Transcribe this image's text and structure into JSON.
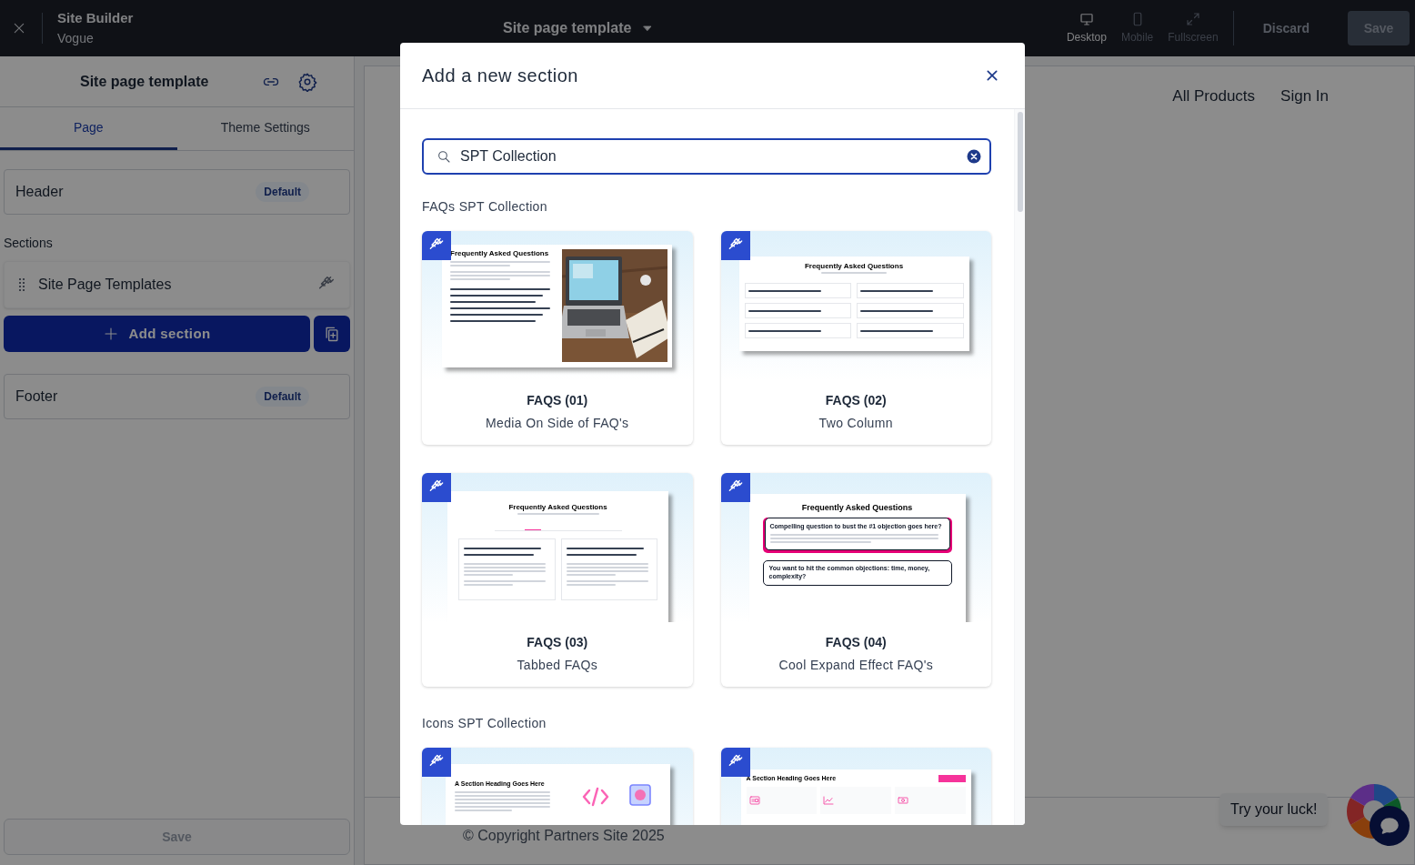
{
  "topbar": {
    "app_title": "Site Builder",
    "site_name": "Vogue",
    "page_selector": "Site page template",
    "devices": [
      {
        "label": "Desktop",
        "kind": "desktop",
        "selected": true
      },
      {
        "label": "Mobile",
        "kind": "mobile",
        "selected": false
      },
      {
        "label": "Fullscreen",
        "kind": "fullscreen",
        "selected": false
      }
    ],
    "discard": {
      "label": "Discard",
      "disabled": true
    },
    "save": {
      "label": "Save",
      "disabled": true
    }
  },
  "sidebar": {
    "title": "Site page template",
    "tabs": [
      {
        "label": "Page",
        "selected": true
      },
      {
        "label": "Theme Settings",
        "selected": false
      }
    ],
    "header": {
      "label": "Header",
      "badge": "Default"
    },
    "sections_label": "Sections",
    "sections": [
      {
        "label": "Site Page Templates"
      }
    ],
    "add_section": "Add section",
    "footer": {
      "label": "Footer",
      "badge": "Default"
    },
    "save": {
      "label": "Save",
      "disabled": true
    }
  },
  "preview": {
    "nav": [
      "All Products",
      "Sign In"
    ],
    "copyright": "© Copyright Partners Site 2025",
    "promo": "Try your luck!"
  },
  "modal": {
    "title": "Add a new section",
    "search": {
      "value": "SPT Collection"
    },
    "groups": [
      {
        "title": "FAQs SPT Collection",
        "cards": [
          {
            "title": "FAQS (01)",
            "subtitle": "Media On Side of FAQ's",
            "preview": {
              "kind": "media_side",
              "heading": "Frequently Asked Questions"
            }
          },
          {
            "title": "FAQS (02)",
            "subtitle": "Two Column",
            "preview": {
              "kind": "two_column",
              "heading": "Frequently Asked Questions"
            }
          },
          {
            "title": "FAQS (03)",
            "subtitle": "Tabbed FAQs",
            "preview": {
              "kind": "tabbed",
              "heading": "Frequently Asked Questions"
            }
          },
          {
            "title": "FAQS (04)",
            "subtitle": "Cool Expand Effect FAQ's",
            "preview": {
              "kind": "expand",
              "heading": "Frequently Asked Questions",
              "items": [
                "Compelling question to bust the #1 objection goes here?",
                "You want to hit the common objections: time, money, complexity?"
              ]
            }
          }
        ]
      },
      {
        "title": "Icons SPT Collection",
        "cards": [
          {
            "preview": {
              "kind": "icons_side",
              "heading": "A Section Heading Goes Here"
            }
          },
          {
            "preview": {
              "kind": "icons_row",
              "heading": "A Section Heading Goes Here"
            }
          }
        ]
      }
    ]
  }
}
